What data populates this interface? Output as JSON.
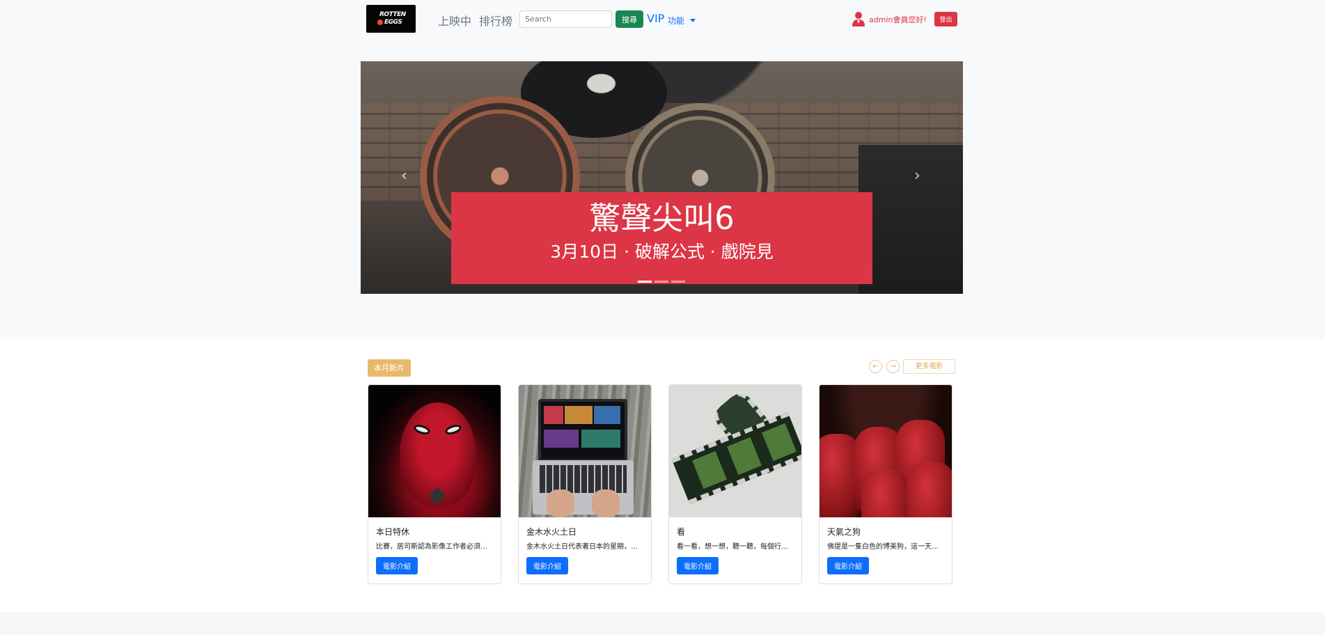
{
  "navbar": {
    "logo_text_line1": "ROTTEN",
    "logo_text_line2": "EGGS",
    "link_showing": "上映中",
    "link_ranking": "排行榜",
    "search_placeholder": "Search",
    "search_button": "搜尋",
    "vip_label": "VIP",
    "feature_dropdown": "功能",
    "greeting": "admin會員您好!",
    "logout_button": "登出"
  },
  "carousel": {
    "title": "驚聲尖叫6",
    "subtitle": "3月10日 · 破解公式 · 戲院見",
    "slide_count": 3,
    "active_slide": 0,
    "prev_icon": "chevron-left-icon",
    "next_icon": "chevron-right-icon"
  },
  "new_releases": {
    "badge": "本月新片",
    "more_button": "更多電影",
    "prev_icon": "arrow-left-icon",
    "next_icon": "arrow-right-icon",
    "movies": [
      {
        "title": "本日特休",
        "desc": "比賽，居司斯認為影像工作者必須…",
        "button": "電影介紹"
      },
      {
        "title": "金木水火土日",
        "desc": "金木水火土日代表著日本的星期，…",
        "button": "電影介紹"
      },
      {
        "title": "看",
        "desc": "看一看，想一想，聽一聽，每個行…",
        "button": "電影介紹"
      },
      {
        "title": "天氣之狗",
        "desc": "佛提是一隻白色的博美狗，這一天…",
        "button": "電影介紹"
      }
    ]
  },
  "colors": {
    "primary": "#0d6efd",
    "success": "#198754",
    "danger": "#dc3545",
    "accent_gold": "#e8b96a"
  }
}
